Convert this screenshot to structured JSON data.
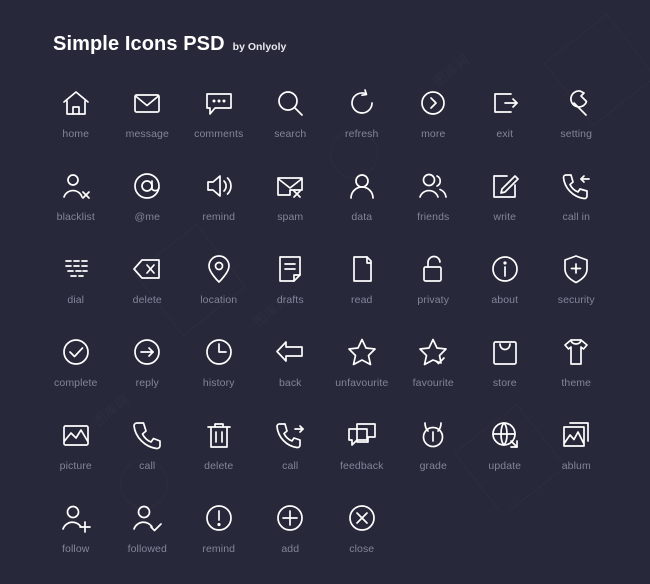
{
  "header": {
    "title": "Simple Icons PSD",
    "byline": "by Onlyoly"
  },
  "colors": {
    "background": "#272839",
    "icon_stroke": "#ffffff",
    "label_text": "#83859a",
    "title_text": "#ffffff"
  },
  "grid": {
    "columns": 8,
    "rows": 5
  },
  "icons": [
    {
      "label": "home",
      "icon": "home-icon"
    },
    {
      "label": "message",
      "icon": "envelope-icon"
    },
    {
      "label": "comments",
      "icon": "chat-bubble-icon"
    },
    {
      "label": "search",
      "icon": "magnifier-icon"
    },
    {
      "label": "refresh",
      "icon": "refresh-arrow-icon"
    },
    {
      "label": "more",
      "icon": "chevron-right-circle-icon"
    },
    {
      "label": "exit",
      "icon": "exit-arrow-icon"
    },
    {
      "label": "setting",
      "icon": "wrench-icon"
    },
    {
      "label": "blacklist",
      "icon": "person-x-icon"
    },
    {
      "label": "@me",
      "icon": "at-sign-icon"
    },
    {
      "label": "remind",
      "icon": "speaker-icon"
    },
    {
      "label": "spam",
      "icon": "envelope-x-icon"
    },
    {
      "label": "data",
      "icon": "person-icon"
    },
    {
      "label": "friends",
      "icon": "two-people-icon"
    },
    {
      "label": "write",
      "icon": "pencil-square-icon"
    },
    {
      "label": "call in",
      "icon": "phone-incoming-icon"
    },
    {
      "label": "dial",
      "icon": "keypad-icon"
    },
    {
      "label": "delete",
      "icon": "backspace-icon"
    },
    {
      "label": "location",
      "icon": "map-pin-icon"
    },
    {
      "label": "drafts",
      "icon": "document-lines-icon"
    },
    {
      "label": "read",
      "icon": "book-page-icon"
    },
    {
      "label": "privaty",
      "icon": "padlock-open-icon"
    },
    {
      "label": "about",
      "icon": "info-circle-icon"
    },
    {
      "label": "security",
      "icon": "shield-plus-icon"
    },
    {
      "label": "complete",
      "icon": "check-circle-icon"
    },
    {
      "label": "reply",
      "icon": "arrow-right-circle-icon"
    },
    {
      "label": "history",
      "icon": "clock-icon"
    },
    {
      "label": "back",
      "icon": "arrow-left-icon"
    },
    {
      "label": "unfavourite",
      "icon": "star-outline-icon"
    },
    {
      "label": "favourite",
      "icon": "star-check-icon"
    },
    {
      "label": "store",
      "icon": "shopping-bag-icon"
    },
    {
      "label": "theme",
      "icon": "tshirt-icon"
    },
    {
      "label": "picture",
      "icon": "image-icon"
    },
    {
      "label": "call",
      "icon": "phone-icon"
    },
    {
      "label": "delete",
      "icon": "trash-can-icon"
    },
    {
      "label": "call",
      "icon": "phone-outgoing-icon"
    },
    {
      "label": "feedback",
      "icon": "chat-bubbles-icon"
    },
    {
      "label": "grade",
      "icon": "medal-icon"
    },
    {
      "label": "update",
      "icon": "globe-arrow-icon"
    },
    {
      "label": "ablum",
      "icon": "image-stack-icon"
    },
    {
      "label": "follow",
      "icon": "person-plus-icon"
    },
    {
      "label": "followed",
      "icon": "person-check-icon"
    },
    {
      "label": "remind",
      "icon": "exclamation-circle-icon"
    },
    {
      "label": "add",
      "icon": "plus-circle-icon"
    },
    {
      "label": "close",
      "icon": "x-circle-icon"
    }
  ],
  "watermark": {
    "text": "图库网"
  }
}
